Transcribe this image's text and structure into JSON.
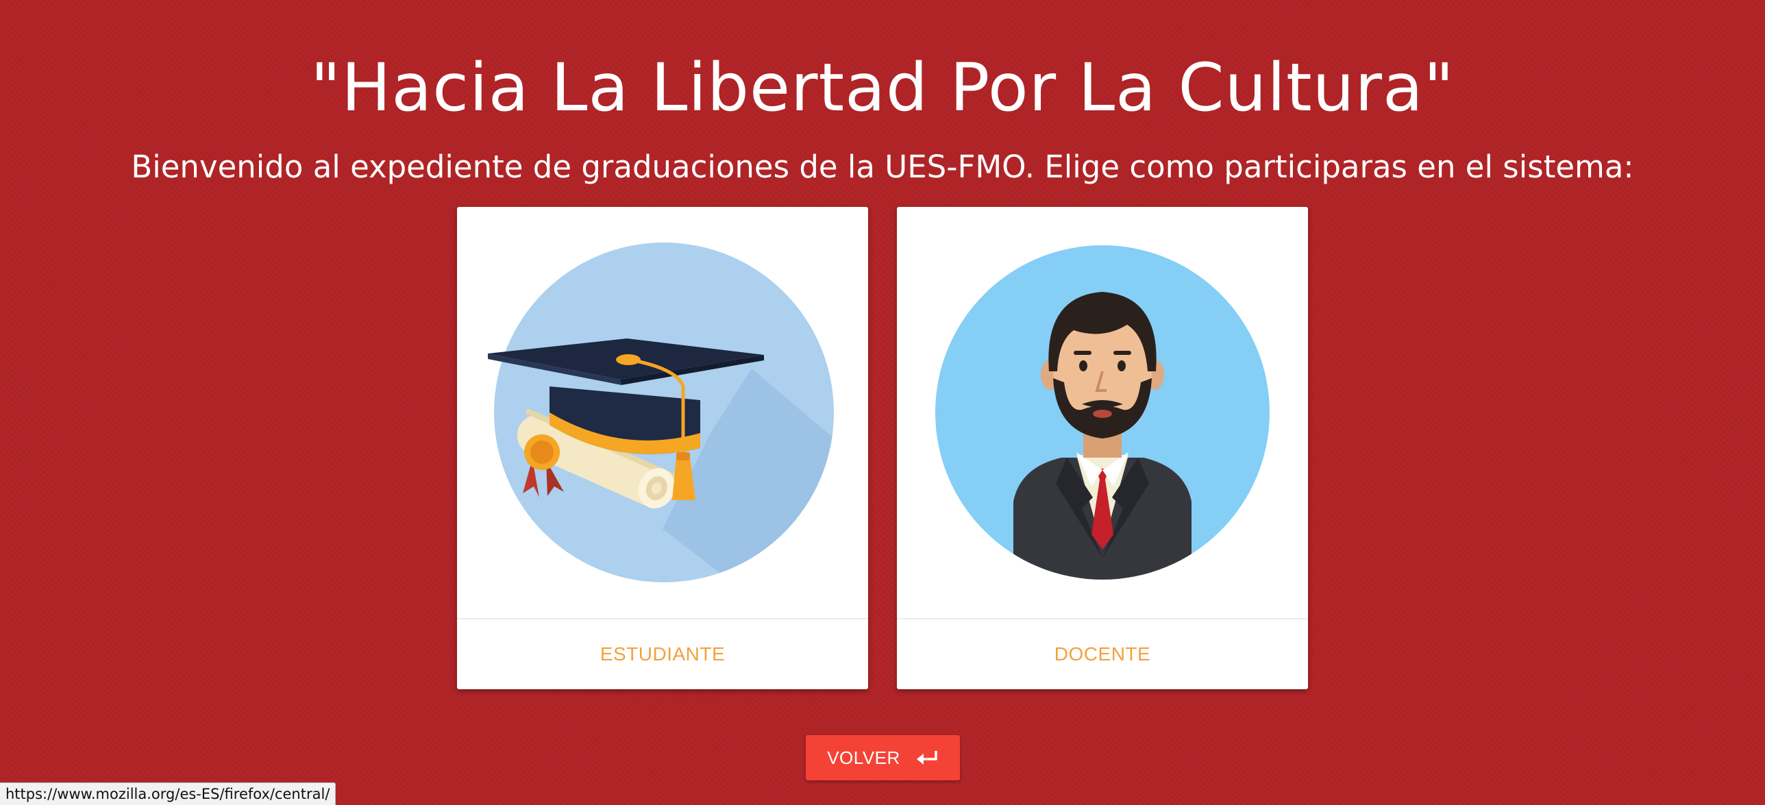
{
  "header": {
    "motto": "\"Hacia La Libertad Por La Cultura\"",
    "subtitle": "Bienvenido al expediente de graduaciones de la UES-FMO. Elige como participaras en el sistema:"
  },
  "roles": [
    {
      "label": "ESTUDIANTE",
      "icon": "graduation-cap-icon"
    },
    {
      "label": "DOCENTE",
      "icon": "teacher-avatar-icon"
    }
  ],
  "back_button": {
    "label": "VOLVER",
    "icon": "return-arrow-icon"
  },
  "status_bar": {
    "url": "https://www.mozilla.org/es-ES/firefox/central/"
  },
  "colors": {
    "background": "#b02326",
    "card_label": "#f4a13c",
    "button": "#f44336"
  }
}
